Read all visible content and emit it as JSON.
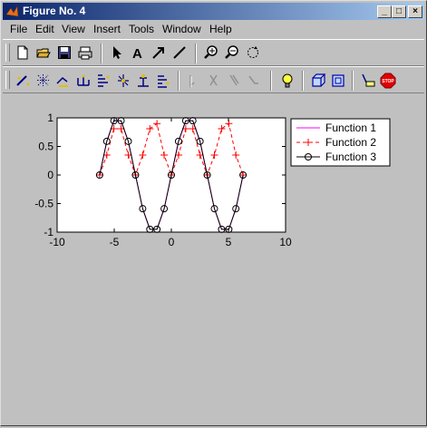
{
  "window": {
    "title": "Figure No. 4"
  },
  "title_buttons": {
    "minimize": "_",
    "maximize": "□",
    "close": "×"
  },
  "menu": [
    {
      "id": "file",
      "label": "File"
    },
    {
      "id": "edit",
      "label": "Edit"
    },
    {
      "id": "view",
      "label": "View"
    },
    {
      "id": "insert",
      "label": "Insert"
    },
    {
      "id": "tools",
      "label": "Tools"
    },
    {
      "id": "window",
      "label": "Window"
    },
    {
      "id": "help",
      "label": "Help"
    }
  ],
  "toolbar1": [
    {
      "name": "new-figure-icon"
    },
    {
      "name": "open-file-icon"
    },
    {
      "name": "save-icon"
    },
    {
      "name": "print-icon"
    },
    {
      "sep": true
    },
    {
      "name": "edit-plot-arrow-icon"
    },
    {
      "name": "insert-text-icon"
    },
    {
      "name": "insert-arrow-icon"
    },
    {
      "name": "insert-line-icon"
    },
    {
      "sep": true
    },
    {
      "name": "zoom-in-icon"
    },
    {
      "name": "zoom-out-icon"
    },
    {
      "name": "rotate-3d-icon"
    }
  ],
  "toolbar2": [
    {
      "name": "plot-edit-tool-1-icon"
    },
    {
      "name": "plot-edit-tool-2-icon"
    },
    {
      "name": "plot-edit-tool-3-icon"
    },
    {
      "name": "plot-edit-tool-4-icon"
    },
    {
      "name": "plot-edit-tool-5-icon"
    },
    {
      "name": "plot-edit-tool-6-icon"
    },
    {
      "name": "plot-edit-tool-7-icon"
    },
    {
      "name": "plot-edit-tool-8-icon"
    },
    {
      "sep": true
    },
    {
      "name": "disabled-tool-1-icon"
    },
    {
      "name": "disabled-tool-2-icon"
    },
    {
      "name": "disabled-tool-3-icon"
    },
    {
      "name": "disabled-tool-4-icon"
    },
    {
      "sep": true
    },
    {
      "name": "lightbulb-icon"
    },
    {
      "sep": true
    },
    {
      "name": "cube-icon"
    },
    {
      "name": "box-icon"
    },
    {
      "sep": true
    },
    {
      "name": "data-tip-icon"
    },
    {
      "name": "stop-icon",
      "label": "STOP"
    }
  ],
  "colors": {
    "f1": "#ff00ff",
    "f2": "#ff0000",
    "f3": "#000000",
    "axes_bg": "#ffffff",
    "figure_bg": "#c0c0c0"
  },
  "chart_data": {
    "type": "line",
    "xlim": [
      -10,
      10
    ],
    "ylim": [
      -1,
      1
    ],
    "xticks": [
      -10,
      -5,
      0,
      5,
      10
    ],
    "yticks": [
      -1,
      -0.5,
      0,
      0.5,
      1
    ],
    "xtick_labels": [
      "-10",
      "-5",
      "0",
      "5",
      "10"
    ],
    "ytick_labels": [
      "-1",
      "-0.5",
      "0",
      "0.5",
      "1"
    ],
    "grid": false,
    "legend_position": "outside-right-top",
    "series": [
      {
        "name": "Function 1",
        "style": "line",
        "color": "#ff00ff",
        "x": [
          -6.28,
          -5.65,
          -5.03,
          -4.4,
          -3.77,
          -3.14,
          -2.51,
          -1.88,
          -1.26,
          -0.63,
          0,
          0.63,
          1.26,
          1.88,
          2.51,
          3.14,
          3.77,
          4.4,
          5.03,
          5.65,
          6.28
        ],
        "y": [
          0,
          0.59,
          0.95,
          0.95,
          0.59,
          0,
          -0.59,
          -0.95,
          -0.95,
          -0.59,
          0,
          0.59,
          0.95,
          0.95,
          0.59,
          0,
          -0.59,
          -0.95,
          -0.95,
          -0.59,
          0
        ]
      },
      {
        "name": "Function 2",
        "style": "dashed-plus",
        "color": "#ff0000",
        "x": [
          -6.28,
          -5.65,
          -5.03,
          -4.4,
          -3.77,
          -3.14,
          -2.51,
          -1.88,
          -1.26,
          -0.63,
          0,
          0.63,
          1.26,
          1.88,
          2.51,
          3.14,
          3.77,
          4.4,
          5.03,
          5.65,
          6.28
        ],
        "y": [
          0,
          0.35,
          0.81,
          0.81,
          0.35,
          0,
          0.35,
          0.81,
          0.9,
          0.35,
          0,
          0.35,
          0.81,
          0.81,
          0.35,
          0,
          0.35,
          0.81,
          0.9,
          0.35,
          0
        ]
      },
      {
        "name": "Function 3",
        "style": "line-circle",
        "color": "#000000",
        "x": [
          -6.28,
          -5.65,
          -5.03,
          -4.4,
          -3.77,
          -3.14,
          -2.51,
          -1.88,
          -1.26,
          -0.63,
          0,
          0.63,
          1.26,
          1.88,
          2.51,
          3.14,
          3.77,
          4.4,
          5.03,
          5.65,
          6.28
        ],
        "y": [
          0,
          0.59,
          0.95,
          0.95,
          0.59,
          0,
          -0.59,
          -0.95,
          -0.95,
          -0.59,
          0,
          0.59,
          0.95,
          0.95,
          0.59,
          0,
          -0.59,
          -0.95,
          -0.95,
          -0.59,
          0
        ]
      }
    ]
  }
}
